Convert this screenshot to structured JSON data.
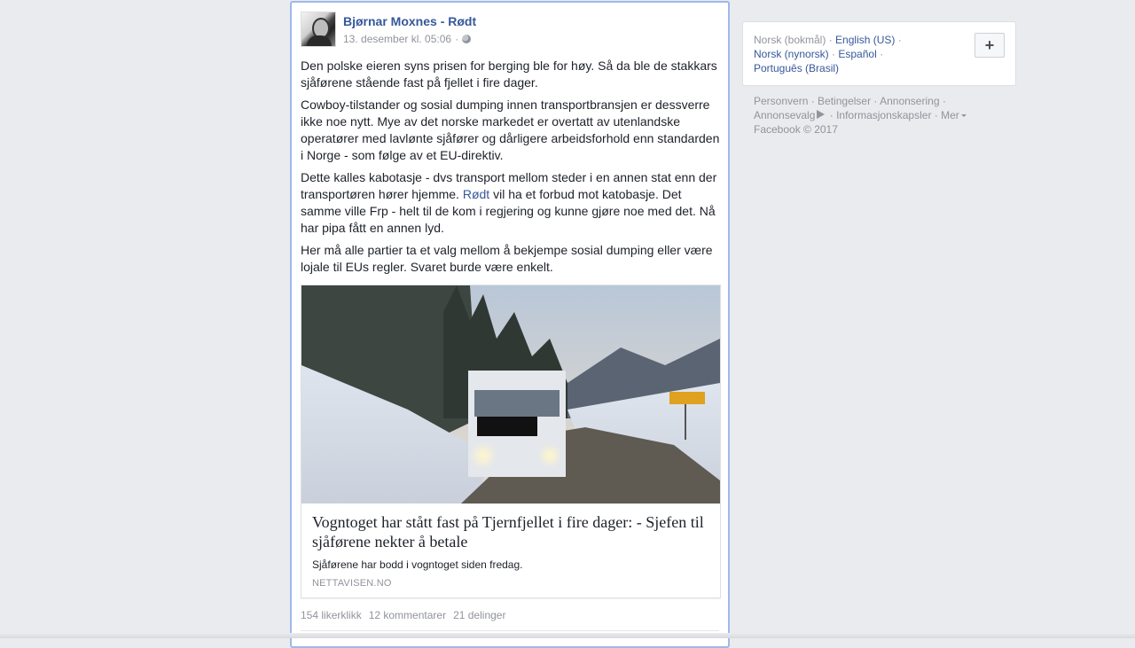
{
  "post": {
    "author": "Bjørnar Moxnes - Rødt",
    "timestamp": "13. desember kl. 05:06",
    "separator": "·",
    "paragraphs": {
      "p1": "Den polske eieren syns prisen for berging ble for høy. Så da ble de stakkars sjåførene stående fast på fjellet i fire dager.",
      "p2": "Cowboy-tilstander og sosial dumping innen transportbransjen er dessverre ikke noe nytt. Mye av det norske markedet er overtatt av utenlandske operatører med lavlønte sjåfører og dårligere arbeidsforhold enn standarden i Norge - som følge av et EU-direktiv.",
      "p3_before": "Dette kalles kabotasje - dvs transport mellom steder i en annen stat enn der transportøren hører hjemme. ",
      "p3_link": "Rødt",
      "p3_after": " vil ha et forbud mot katobasje. Det samme ville Frp - helt til de kom i regjering og kunne gjøre noe med det. Nå har pipa fått en annen lyd.",
      "p4": "Her må alle partier ta et valg mellom å bekjempe sosial dumping eller være lojale til EUs regler. Svaret burde være enkelt."
    },
    "link_card": {
      "title": "Vogntoget har stått fast på Tjernfjellet i fire dager: - Sjefen til sjåførene nekter å betale",
      "description": "Sjåførene har bodd i vogntoget siden fredag.",
      "source": "NETTAVISEN.NO"
    },
    "stats": {
      "likes": "154 likerklikk",
      "comments": "12 kommentarer",
      "shares": "21 delinger"
    }
  },
  "sidebar": {
    "languages": {
      "current": "Norsk (bokmål)",
      "options": [
        "English (US)",
        "Norsk (nynorsk)",
        "Español",
        "Português (Brasil)"
      ],
      "separator": "·",
      "add_label": "+"
    },
    "footer": {
      "links": [
        "Personvern",
        "Betingelser",
        "Annonsering",
        "Annonsevalg",
        "Informasjonskapsler",
        "Mer"
      ],
      "copyright": "Facebook © 2017"
    }
  },
  "colors": {
    "link": "#365899",
    "meta": "#90949c",
    "background": "#e9ebee",
    "focus_border": "#9fb8ec"
  }
}
